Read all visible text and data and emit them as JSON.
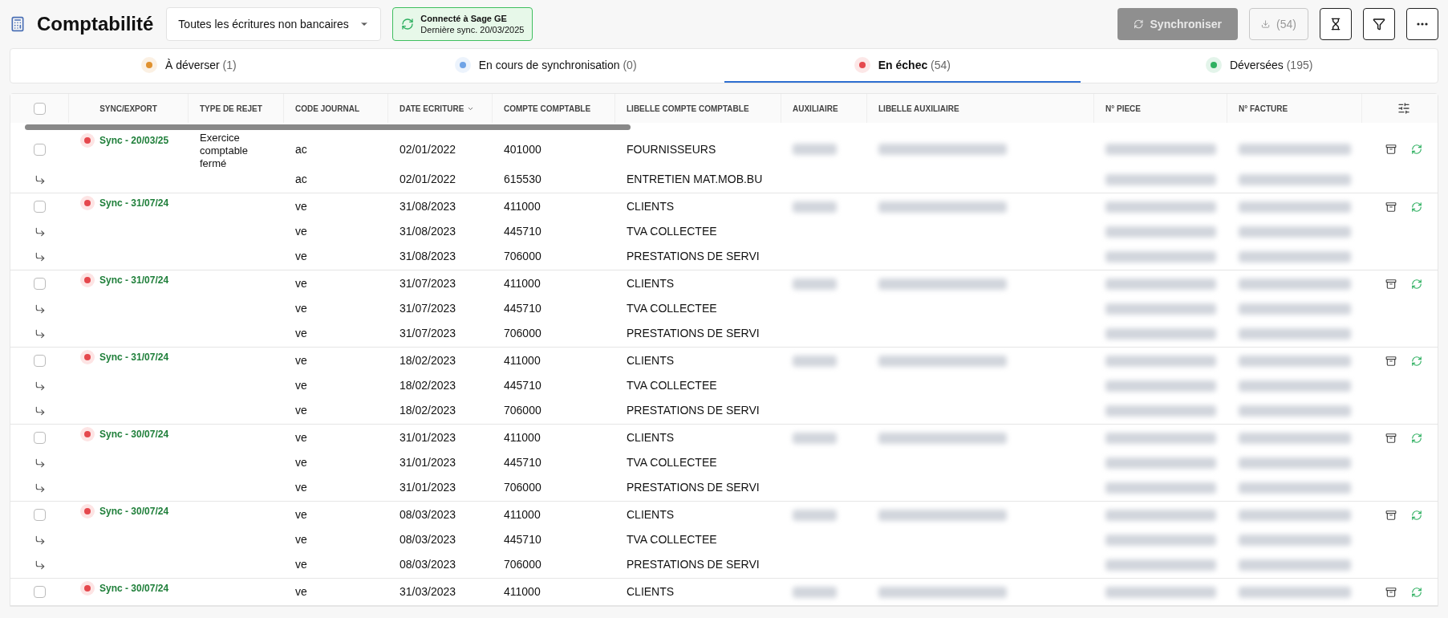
{
  "header": {
    "title": "Comptabilité",
    "filter_select": {
      "value": "Toutes les écritures non bancaires"
    },
    "connection": {
      "title": "Connecté à Sage GE",
      "subtitle": "Dernière sync. 20/03/2025"
    },
    "sync_button": {
      "label": "Synchroniser",
      "disabled": true
    },
    "download_button": {
      "label": "(54)",
      "disabled": true
    }
  },
  "tabs": [
    {
      "label": "À déverser",
      "count": "(1)",
      "color": "#e0912f",
      "selected": false
    },
    {
      "label": "En cours de synchronisation",
      "count": "(0)",
      "color": "#6fa3e6",
      "selected": false
    },
    {
      "label": "En échec",
      "count": "(54)",
      "color": "#e5484d",
      "selected": true
    },
    {
      "label": "Déversées",
      "count": "(195)",
      "color": "#2fb061",
      "selected": false
    }
  ],
  "table": {
    "select_all_checked": false,
    "columns": [
      {
        "label": "SYNC/EXPORT",
        "sorted": false
      },
      {
        "label": "TYPE DE REJET",
        "sorted": false
      },
      {
        "label": "CODE JOURNAL",
        "sorted": false
      },
      {
        "label": "DATE ECRITURE",
        "sorted": true
      },
      {
        "label": "COMPTE COMPTABLE",
        "sorted": false
      },
      {
        "label": "LIBELLE COMPTE COMPTABLE",
        "sorted": false
      },
      {
        "label": "AUXILIAIRE",
        "sorted": false
      },
      {
        "label": "LIBELLE AUXILIAIRE",
        "sorted": false
      },
      {
        "label": "N° PIECE",
        "sorted": false
      },
      {
        "label": "N° FACTURE",
        "sorted": false
      }
    ],
    "groups": [
      {
        "sync": "Sync - 20/03/25",
        "reject_type": "Exercice comptable fermé",
        "checked": false,
        "lines": [
          {
            "journal": "ac",
            "date": "02/01/2022",
            "account": "401000",
            "account_label": "FOURNISSEURS"
          },
          {
            "journal": "ac",
            "date": "02/01/2022",
            "account": "615530",
            "account_label": "ENTRETIEN MAT.MOB.BU"
          }
        ]
      },
      {
        "sync": "Sync - 31/07/24",
        "checked": false,
        "lines": [
          {
            "journal": "ve",
            "date": "31/08/2023",
            "account": "411000",
            "account_label": "CLIENTS"
          },
          {
            "journal": "ve",
            "date": "31/08/2023",
            "account": "445710",
            "account_label": "TVA COLLECTEE"
          },
          {
            "journal": "ve",
            "date": "31/08/2023",
            "account": "706000",
            "account_label": "PRESTATIONS DE SERVI"
          }
        ]
      },
      {
        "sync": "Sync - 31/07/24",
        "checked": false,
        "lines": [
          {
            "journal": "ve",
            "date": "31/07/2023",
            "account": "411000",
            "account_label": "CLIENTS"
          },
          {
            "journal": "ve",
            "date": "31/07/2023",
            "account": "445710",
            "account_label": "TVA COLLECTEE"
          },
          {
            "journal": "ve",
            "date": "31/07/2023",
            "account": "706000",
            "account_label": "PRESTATIONS DE SERVI"
          }
        ]
      },
      {
        "sync": "Sync - 31/07/24",
        "checked": false,
        "lines": [
          {
            "journal": "ve",
            "date": "18/02/2023",
            "account": "411000",
            "account_label": "CLIENTS"
          },
          {
            "journal": "ve",
            "date": "18/02/2023",
            "account": "445710",
            "account_label": "TVA COLLECTEE"
          },
          {
            "journal": "ve",
            "date": "18/02/2023",
            "account": "706000",
            "account_label": "PRESTATIONS DE SERVI"
          }
        ]
      },
      {
        "sync": "Sync - 30/07/24",
        "checked": false,
        "lines": [
          {
            "journal": "ve",
            "date": "31/01/2023",
            "account": "411000",
            "account_label": "CLIENTS"
          },
          {
            "journal": "ve",
            "date": "31/01/2023",
            "account": "445710",
            "account_label": "TVA COLLECTEE"
          },
          {
            "journal": "ve",
            "date": "31/01/2023",
            "account": "706000",
            "account_label": "PRESTATIONS DE SERVI"
          }
        ]
      },
      {
        "sync": "Sync - 30/07/24",
        "checked": false,
        "lines": [
          {
            "journal": "ve",
            "date": "08/03/2023",
            "account": "411000",
            "account_label": "CLIENTS"
          },
          {
            "journal": "ve",
            "date": "08/03/2023",
            "account": "445710",
            "account_label": "TVA COLLECTEE"
          },
          {
            "journal": "ve",
            "date": "08/03/2023",
            "account": "706000",
            "account_label": "PRESTATIONS DE SERVI"
          }
        ]
      },
      {
        "sync": "Sync - 30/07/24",
        "checked": false,
        "lines": [
          {
            "journal": "ve",
            "date": "31/03/2023",
            "account": "411000",
            "account_label": "CLIENTS"
          }
        ]
      }
    ]
  }
}
